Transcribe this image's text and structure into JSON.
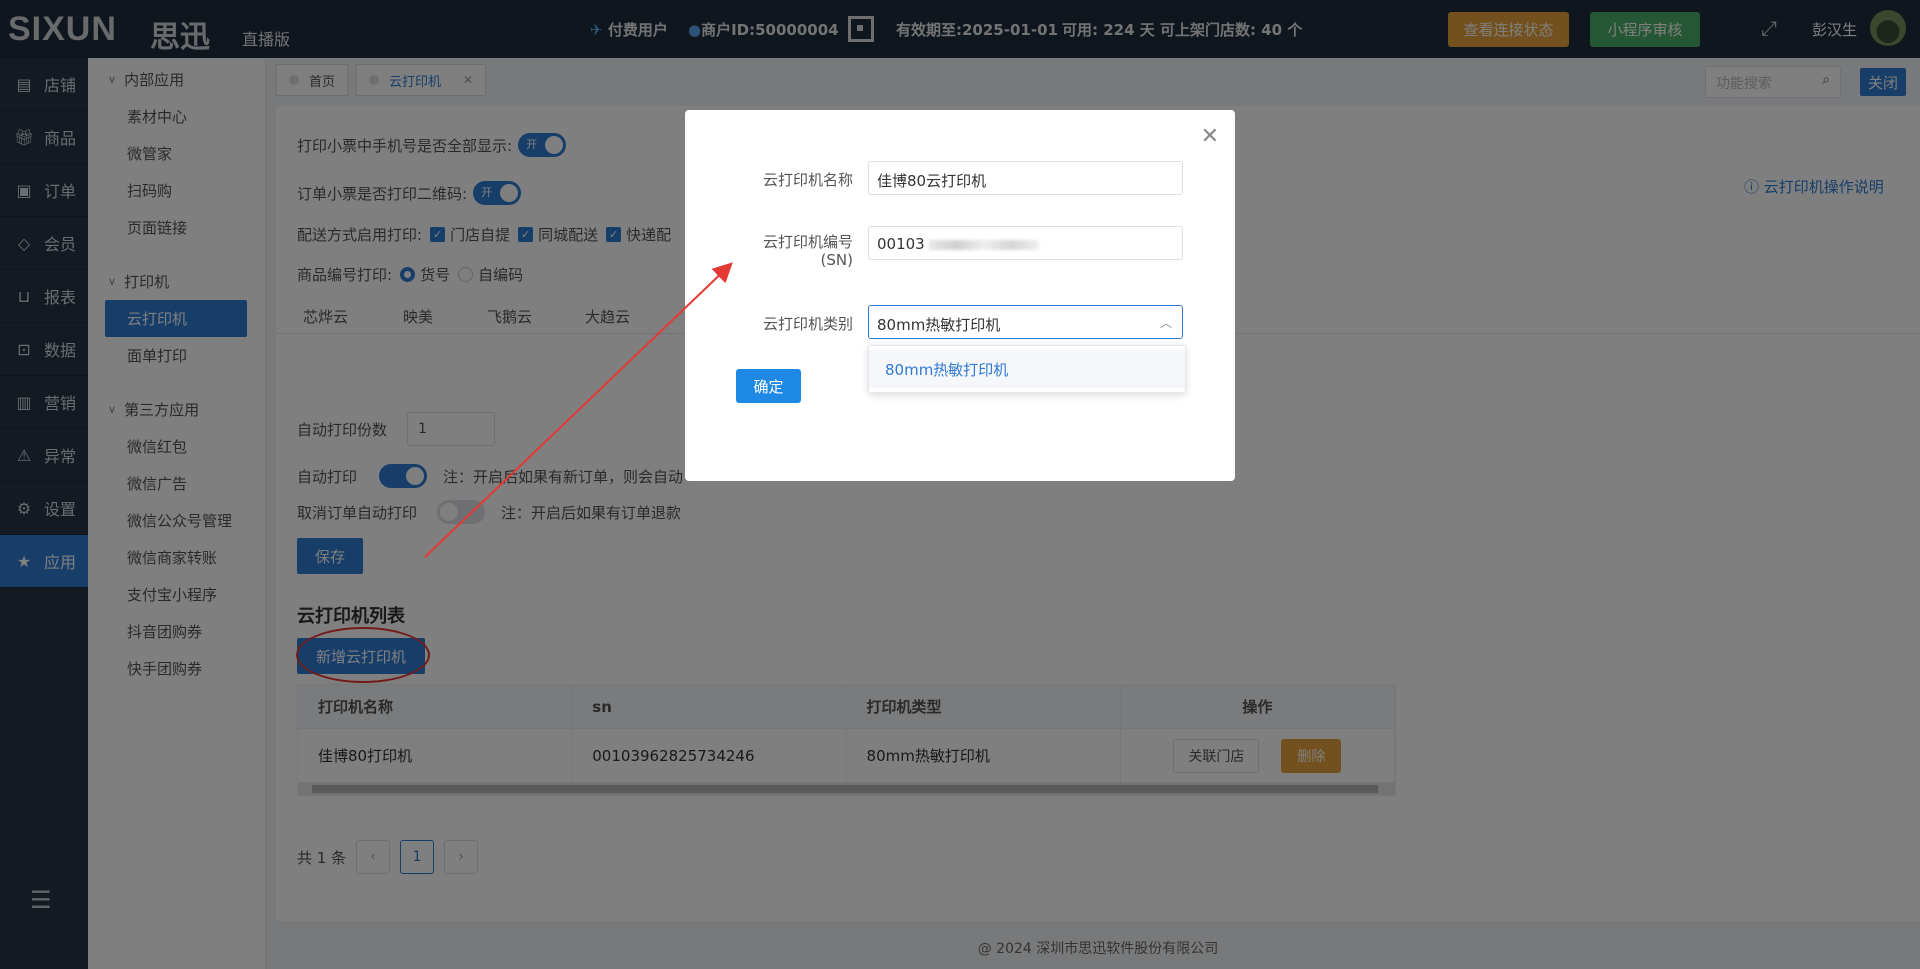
{
  "header": {
    "logo": "SIXUN",
    "logo_cn": "思迅",
    "edition": "直播版",
    "paid_user": "付费用户",
    "merchant_id": "商户ID:50000004",
    "valid_until": "有效期至:2025-01-01",
    "available": "可用: 224 天",
    "stores": "可上架门店数: 40 个",
    "check_conn_btn": "查看连接状态",
    "mini_review_btn": "小程序审核",
    "username": "彭汉生"
  },
  "sidebar": {
    "items": [
      {
        "label": "店铺",
        "icon": "store-icon"
      },
      {
        "label": "商品",
        "icon": "gift-icon"
      },
      {
        "label": "订单",
        "icon": "order-icon"
      },
      {
        "label": "会员",
        "icon": "diamond-icon"
      },
      {
        "label": "报表",
        "icon": "basket-icon"
      },
      {
        "label": "数据",
        "icon": "lock-icon"
      },
      {
        "label": "营销",
        "icon": "chart-icon"
      },
      {
        "label": "异常",
        "icon": "warning-icon"
      },
      {
        "label": "设置",
        "icon": "gear-icon"
      },
      {
        "label": "应用",
        "icon": "star-icon"
      }
    ]
  },
  "subnav": {
    "group1": "内部应用",
    "group1_items": [
      "素材中心",
      "微管家",
      "扫码购",
      "页面链接"
    ],
    "group2": "打印机",
    "group2_items": [
      "云打印机",
      "面单打印"
    ],
    "group3": "第三方应用",
    "group3_items": [
      "微信红包",
      "微信广告",
      "微信公众号管理",
      "微信商家转账",
      "支付宝小程序",
      "抖音团购券",
      "快手团购券"
    ]
  },
  "tabs": {
    "home": "首页",
    "cloud": "云打印机"
  },
  "search_placeholder": "功能搜索",
  "close_label": "关闭",
  "help_link": "云打印机操作说明",
  "settings": {
    "phone_full": "打印小票中手机号是否全部显示:",
    "on": "开",
    "qrcode": "订单小票是否打印二维码:",
    "delivery": "配送方式启用打印:",
    "d1": "门店自提",
    "d2": "同城配送",
    "d3": "快递配",
    "code_print": "商品编号打印:",
    "r1": "货号",
    "r2": "自编码"
  },
  "printer_tabs": [
    "芯烨云",
    "映美",
    "飞鹅云",
    "大趋云"
  ],
  "auto_copies_label": "自动打印份数",
  "auto_copies_value": "1",
  "auto_print_label": "自动打印",
  "auto_print_note": "注：开启后如果有新订单，则会自动",
  "cancel_print_label": "取消订单自动打印",
  "cancel_print_note": "注：开启后如果有订单退款",
  "save_btn": "保存",
  "list_title": "云打印机列表",
  "add_btn": "新增云打印机",
  "table": {
    "headers": [
      "打印机名称",
      "sn",
      "打印机类型",
      "操作"
    ],
    "rows": [
      {
        "name": "佳博80打印机",
        "sn": "00103962825734246",
        "type": "80mm热敏打印机"
      }
    ],
    "link_btn": "关联门店",
    "del_btn": "删除"
  },
  "pager": {
    "total": "共 1 条",
    "prev": "‹",
    "page": "1",
    "next": "›"
  },
  "footer": "@ 2024 深圳市思迅软件股份有限公司",
  "dialog": {
    "name_label": "云打印机名称",
    "name_value": "佳博80云打印机",
    "sn_label": "云打印机编号",
    "sn_label2": "(SN)",
    "sn_value": "00103",
    "type_label": "云打印机类别",
    "type_value": "80mm热敏打印机",
    "ok_btn": "确定",
    "option": "80mm热敏打印机"
  }
}
